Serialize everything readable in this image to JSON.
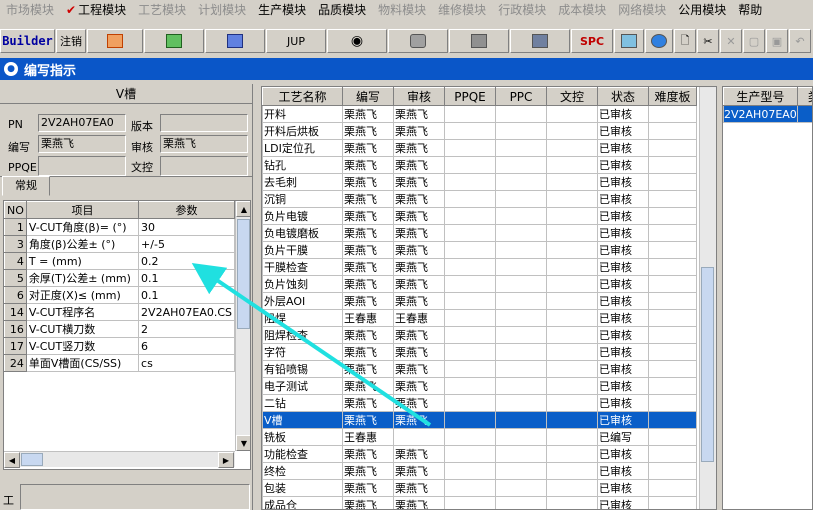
{
  "menu": [
    {
      "label": "市场模块",
      "enabled": false
    },
    {
      "label": "工程模块",
      "enabled": true,
      "checked": true
    },
    {
      "label": "工艺模块",
      "enabled": false
    },
    {
      "label": "计划模块",
      "enabled": false
    },
    {
      "label": "生产模块",
      "enabled": true
    },
    {
      "label": "品质模块",
      "enabled": true
    },
    {
      "label": "物料模块",
      "enabled": false
    },
    {
      "label": "维修模块",
      "enabled": false
    },
    {
      "label": "行政模块",
      "enabled": false
    },
    {
      "label": "成本模块",
      "enabled": false
    },
    {
      "label": "网络模块",
      "enabled": false
    },
    {
      "label": "公用模块",
      "enabled": true
    },
    {
      "label": "帮助",
      "enabled": true
    }
  ],
  "toolbar": {
    "builder": "Builder",
    "logout": "注销",
    "jup": "JUP",
    "spc": "SPC"
  },
  "window_title": "编写指示",
  "left": {
    "title": "V槽",
    "pn_label": "PN",
    "pn_value": "2V2AH07EA0",
    "version_label": "版本",
    "version_value": "",
    "writer_label": "编写",
    "writer_value": "栗燕飞",
    "reviewer_label": "审核",
    "reviewer_value": "栗燕飞",
    "ppqe_label": "PPQE",
    "ppqe_value": "",
    "wenkong_label": "文控",
    "wenkong_value": "",
    "tab_label": "常规",
    "params_headers": [
      "NO",
      "项目",
      "参数"
    ],
    "params": [
      {
        "no": "1",
        "item": "V-CUT角度(β)= (°)",
        "value": "30"
      },
      {
        "no": "3",
        "item": "角度(β)公差± (°)",
        "value": "+/-5"
      },
      {
        "no": "4",
        "item": "T = (mm)",
        "value": "0.2"
      },
      {
        "no": "5",
        "item": "余厚(T)公差± (mm)",
        "value": "0.1"
      },
      {
        "no": "6",
        "item": "对正度(X)≤ (mm)",
        "value": "0.1"
      },
      {
        "no": "14",
        "item": "V-CUT程序名",
        "value": "2V2AH07EA0.CS"
      },
      {
        "no": "16",
        "item": "V-CUT横刀数",
        "value": "2"
      },
      {
        "no": "17",
        "item": "V-CUT竖刀数",
        "value": "6"
      },
      {
        "no": "24",
        "item": "单面V槽面(CS/SS)",
        "value": "cs"
      }
    ],
    "bottom_label": "工"
  },
  "process_headers": [
    "工艺名称",
    "编写",
    "审核",
    "PPQE",
    "PPC",
    "文控",
    "状态",
    "难度板"
  ],
  "processes": [
    {
      "name": "开料",
      "writer": "栗燕飞",
      "reviewer": "栗燕飞",
      "status": "已审核"
    },
    {
      "name": "开料后烘板",
      "writer": "栗燕飞",
      "reviewer": "栗燕飞",
      "status": "已审核"
    },
    {
      "name": "LDI定位孔",
      "writer": "栗燕飞",
      "reviewer": "栗燕飞",
      "status": "已审核"
    },
    {
      "name": "钻孔",
      "writer": "栗燕飞",
      "reviewer": "栗燕飞",
      "status": "已审核"
    },
    {
      "name": "去毛刺",
      "writer": "栗燕飞",
      "reviewer": "栗燕飞",
      "status": "已审核"
    },
    {
      "name": "沉铜",
      "writer": "栗燕飞",
      "reviewer": "栗燕飞",
      "status": "已审核"
    },
    {
      "name": "负片电镀",
      "writer": "栗燕飞",
      "reviewer": "栗燕飞",
      "status": "已审核"
    },
    {
      "name": "负电镀磨板",
      "writer": "栗燕飞",
      "reviewer": "栗燕飞",
      "status": "已审核"
    },
    {
      "name": "负片干膜",
      "writer": "栗燕飞",
      "reviewer": "栗燕飞",
      "status": "已审核"
    },
    {
      "name": "干膜检查",
      "writer": "栗燕飞",
      "reviewer": "栗燕飞",
      "status": "已审核"
    },
    {
      "name": "负片蚀刻",
      "writer": "栗燕飞",
      "reviewer": "栗燕飞",
      "status": "已审核"
    },
    {
      "name": "外层AOI",
      "writer": "栗燕飞",
      "reviewer": "栗燕飞",
      "status": "已审核"
    },
    {
      "name": "阻焊",
      "writer": "王春惠",
      "reviewer": "王春惠",
      "status": "已审核"
    },
    {
      "name": "阻焊检查",
      "writer": "栗燕飞",
      "reviewer": "栗燕飞",
      "status": "已审核"
    },
    {
      "name": "字符",
      "writer": "栗燕飞",
      "reviewer": "栗燕飞",
      "status": "已审核"
    },
    {
      "name": "有铅喷锡",
      "writer": "栗燕飞",
      "reviewer": "栗燕飞",
      "status": "已审核"
    },
    {
      "name": "电子测试",
      "writer": "栗燕飞",
      "reviewer": "栗燕飞",
      "status": "已审核"
    },
    {
      "name": "二钻",
      "writer": "栗燕飞",
      "reviewer": "栗燕飞",
      "status": "已审核"
    },
    {
      "name": "V槽",
      "writer": "栗燕飞",
      "reviewer": "栗燕飞",
      "status": "已审核",
      "selected": true
    },
    {
      "name": "铣板",
      "writer": "王春惠",
      "reviewer": "",
      "status": "已编写"
    },
    {
      "name": "功能检查",
      "writer": "栗燕飞",
      "reviewer": "栗燕飞",
      "status": "已审核"
    },
    {
      "name": "终检",
      "writer": "栗燕飞",
      "reviewer": "栗燕飞",
      "status": "已审核"
    },
    {
      "name": "包装",
      "writer": "栗燕飞",
      "reviewer": "栗燕飞",
      "status": "已审核"
    },
    {
      "name": "成品仓",
      "writer": "栗燕飞",
      "reviewer": "栗燕飞",
      "status": "已审核"
    }
  ],
  "right": {
    "headers": [
      "生产型号",
      "类别"
    ],
    "rows": [
      {
        "model": "2V2AH07EA0",
        "type": ""
      }
    ]
  }
}
